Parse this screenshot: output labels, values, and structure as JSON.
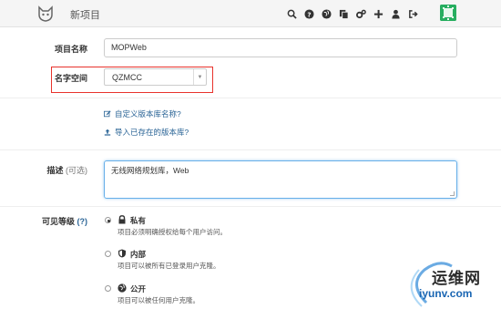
{
  "header": {
    "title": "新项目",
    "icons": [
      "search-icon",
      "question-icon",
      "globe-icon",
      "copy-icon",
      "gears-icon",
      "plus-icon",
      "user-icon",
      "sign-out-icon"
    ]
  },
  "form": {
    "project_name_label": "项目名称",
    "project_name_value": "MOPWeb",
    "namespace_label": "名字空间",
    "namespace_value": "QZMCC",
    "customize_path_link": "自定义版本库名称?",
    "import_existing_link": "导入已存在的版本库?",
    "description_label": "描述",
    "description_optional": "(可选)",
    "description_value": "无线网络规划库，Web",
    "visibility_label": "可见等级",
    "visibility_help": "(?)"
  },
  "visibility_options": [
    {
      "title": "私有",
      "desc": "项目必须明确授权给每个用户访问。",
      "checked": true,
      "icon": "lock-icon"
    },
    {
      "title": "内部",
      "desc": "项目可以被所有已登录用户克隆。",
      "checked": false,
      "icon": "shield-icon"
    },
    {
      "title": "公开",
      "desc": "项目可以被任何用户克隆。",
      "checked": false,
      "icon": "globe-icon"
    }
  ],
  "watermark": {
    "brand": "运维网",
    "url": "iyunv.com"
  },
  "colors": {
    "highlight": "#e8332c",
    "link": "#2a6496",
    "avatar": "#27ae60"
  }
}
